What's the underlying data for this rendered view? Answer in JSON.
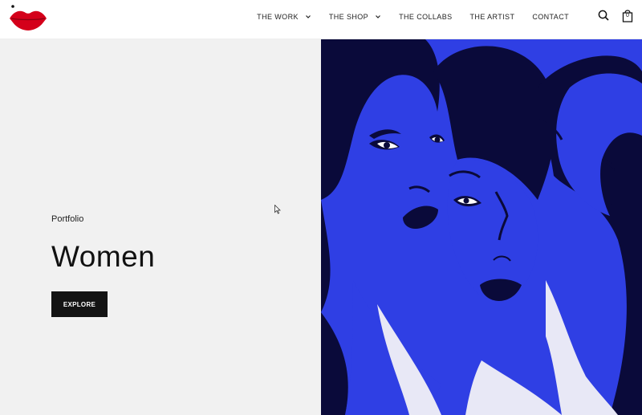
{
  "nav": {
    "items": [
      {
        "label": "THE WORK",
        "dropdown": true
      },
      {
        "label": "THE SHOP",
        "dropdown": true
      },
      {
        "label": "THE COLLABS",
        "dropdown": false
      },
      {
        "label": "THE ARTIST",
        "dropdown": false
      },
      {
        "label": "CONTACT",
        "dropdown": false
      }
    ]
  },
  "header_icons": {
    "search": "search-icon",
    "cart": "shopping-bag-icon",
    "cart_count": "0"
  },
  "hero": {
    "eyebrow": "Portfolio",
    "title": "Women",
    "cta_label": "EXPLORE"
  },
  "colors": {
    "logo_red": "#d4001a",
    "hero_left_bg": "#f1f1f1",
    "art_blue": "#2f3fe4",
    "art_navy": "#0a0a3a",
    "art_white": "#e8e8f6",
    "button_bg": "#141414"
  }
}
